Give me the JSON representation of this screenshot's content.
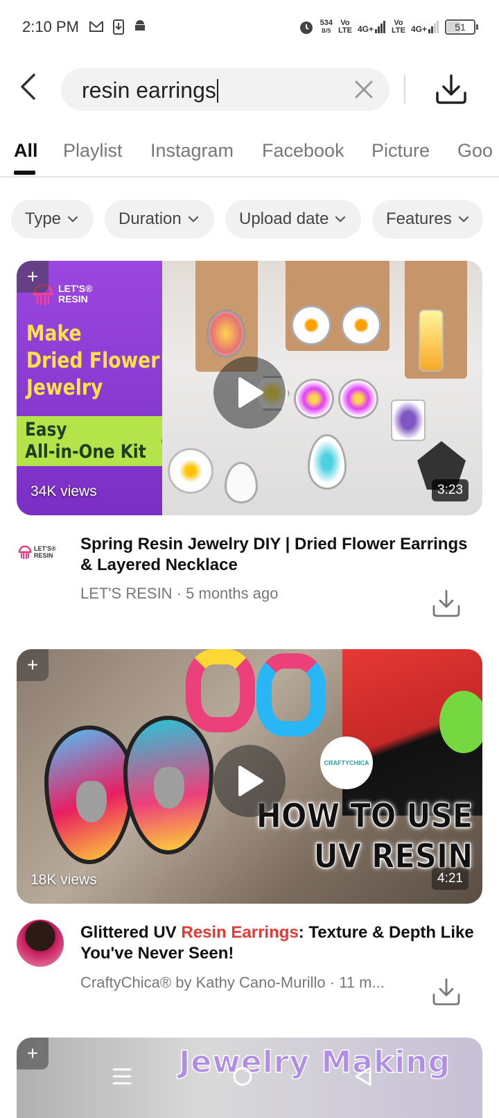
{
  "status_bar": {
    "time": "2:10 PM",
    "net_speed_value": "534",
    "net_speed_unit": "B/S",
    "sim1_top": "Vo",
    "sim1_bottom": "LTE",
    "sim1_net": "4G+",
    "sim2_top": "Vo",
    "sim2_bottom": "LTE",
    "sim2_net": "4G+",
    "battery": "51",
    "battery_level": 0.51,
    "icons": [
      "gmail-icon",
      "download-notification-icon",
      "android-icon",
      "alarm-icon"
    ]
  },
  "search": {
    "query": "resin earrings"
  },
  "tabs": [
    {
      "label": "All",
      "active": true
    },
    {
      "label": "Playlist"
    },
    {
      "label": "Instagram"
    },
    {
      "label": "Facebook"
    },
    {
      "label": "Picture"
    },
    {
      "label": "Goo"
    }
  ],
  "filters": [
    {
      "label": "Type"
    },
    {
      "label": "Duration"
    },
    {
      "label": "Upload date"
    },
    {
      "label": "Features"
    }
  ],
  "videos": [
    {
      "views": "34K views",
      "duration": "3:23",
      "thumb_logo_line1": "LET'S®",
      "thumb_logo_line2": "RESIN",
      "thumb_headline": [
        "Make",
        "Dried Flower",
        "Jewelry"
      ],
      "thumb_banner": [
        "Easy",
        "All-in-One Kit"
      ],
      "avatar_line1": "LET'S®",
      "avatar_line2": "RESIN",
      "title": "Spring Resin Jewelry DIY | Dried Flower Earrings & Layered Necklace",
      "channel": "LET'S RESIN",
      "age": "5 months ago"
    },
    {
      "views": "18K views",
      "duration": "4:21",
      "thumb_logo": "CRAFTYCHICA",
      "thumb_text_line1": "HOW TO USE",
      "thumb_text_line2": "UV RESIN",
      "title_before": "Glittered UV ",
      "title_highlight": "Resin Earrings",
      "title_after": ": Texture & Depth Like You've Never Seen!",
      "channel_and_age": "CraftyChica® by Kathy Cano-Murillo · 11 m..."
    },
    {
      "thumb_text": "Jewelry Making"
    }
  ],
  "colors": {
    "highlight": "#e53935",
    "chip_bg": "#f1f1f1",
    "search_bg": "#f2f2f2",
    "thumb1_left": "#8b3fd6",
    "thumb1_banner": "#b5e34a"
  }
}
